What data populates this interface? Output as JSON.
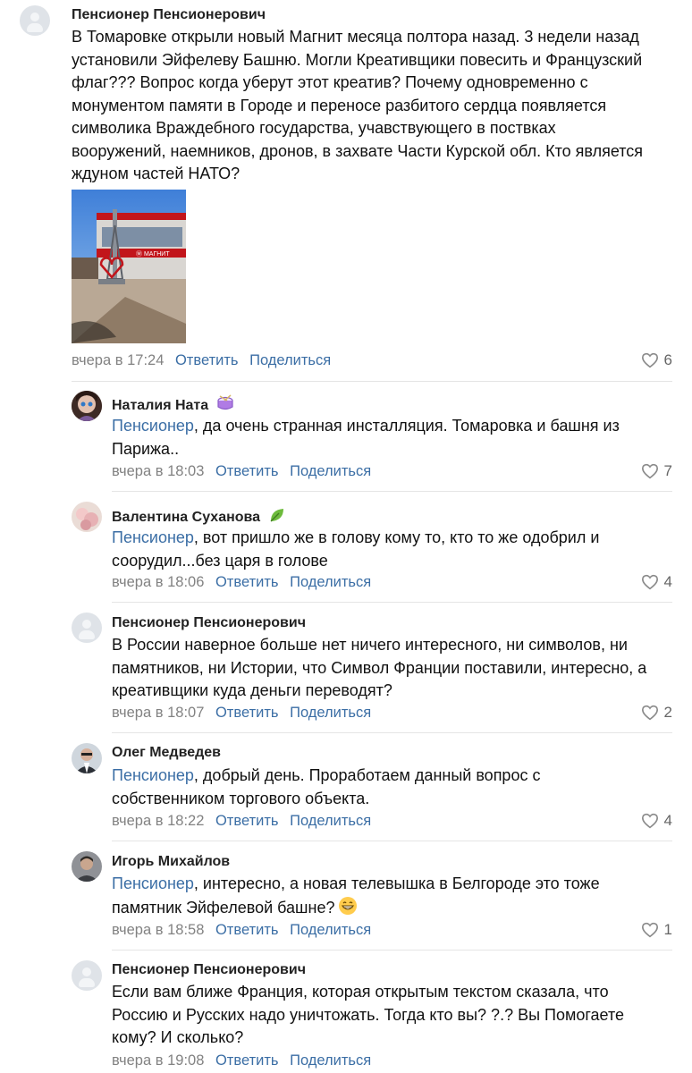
{
  "comments": [
    {
      "author": "Пенсионер Пенсионерович",
      "lines": [
        "В Томаровке открыли новый Магнит месяца полтора назад. 3 недели назад",
        "установили Эйфелеву Башню. Могли Креативщики повесить и Французский",
        "флаг??? Вопрос когда уберут этот креатив? Почему одновременно с",
        "монументом памяти в Городе и переносе разбитого сердца появляется",
        "символика Враждебного государства, учавствующего в поствках",
        "вооружений, наемников, дронов, в захвате Части Курской обл. Кто является",
        "ждуном частей НАТО?"
      ],
      "time": "вчера в 17:24",
      "reply": "Ответить",
      "share": "Поделиться",
      "likes": "6",
      "photo_sign": "Ⓜ МАГНИТ"
    },
    {
      "author": "Наталия Ната",
      "reply_to": "Пенсионер",
      "text_line1": ", да очень странная инсталляция. Томаровка и башня из",
      "text_line2": "Парижа..",
      "time": "вчера в 18:03",
      "reply": "Ответить",
      "share": "Поделиться",
      "likes": "7"
    },
    {
      "author": "Валентина Суханова",
      "reply_to": "Пенсионер",
      "text_line1": ", вот пришло же в голову кому то, кто то же одобрил и",
      "text_line2": "соорудил...без царя в голове",
      "time": "вчера в 18:06",
      "reply": "Ответить",
      "share": "Поделиться",
      "likes": "4"
    },
    {
      "author": "Пенсионер Пенсионерович",
      "lines": [
        "В России наверное больше нет ничего интересного, ни символов, ни",
        "памятников, ни Истории, что Символ Франции поставили, интересно, а",
        "креативщики куда деньги переводят?"
      ],
      "time": "вчера в 18:07",
      "reply": "Ответить",
      "share": "Поделиться",
      "likes": "2"
    },
    {
      "author": "Олег Медведев",
      "reply_to": "Пенсионер",
      "text_line1": ", добрый день. Проработаем данный вопрос с",
      "text_line2": "собственником торгового объекта.",
      "time": "вчера в 18:22",
      "reply": "Ответить",
      "share": "Поделиться",
      "likes": "4"
    },
    {
      "author": "Игорь Михайлов",
      "reply_to": "Пенсионер",
      "text_line1": ", интересно, а новая телевышка в Белгороде это тоже",
      "text_line2": "памятник Эйфелевой башне?",
      "time": "вчера в 18:58",
      "reply": "Ответить",
      "share": "Поделиться",
      "likes": "1"
    },
    {
      "author": "Пенсионер Пенсионерович",
      "lines": [
        "Если вам ближе Франция, которая открытым текстом сказала, что",
        "Россию и Русских надо уничтожать. Тогда кто вы? ?.? Вы Помогаете",
        "кому? И сколько?"
      ],
      "time": "вчера в 19:08",
      "reply": "Ответить",
      "share": "Поделиться"
    }
  ],
  "colors": {
    "link": "#3b6ea5",
    "meta": "#828282",
    "separator": "#e5e5e5"
  }
}
